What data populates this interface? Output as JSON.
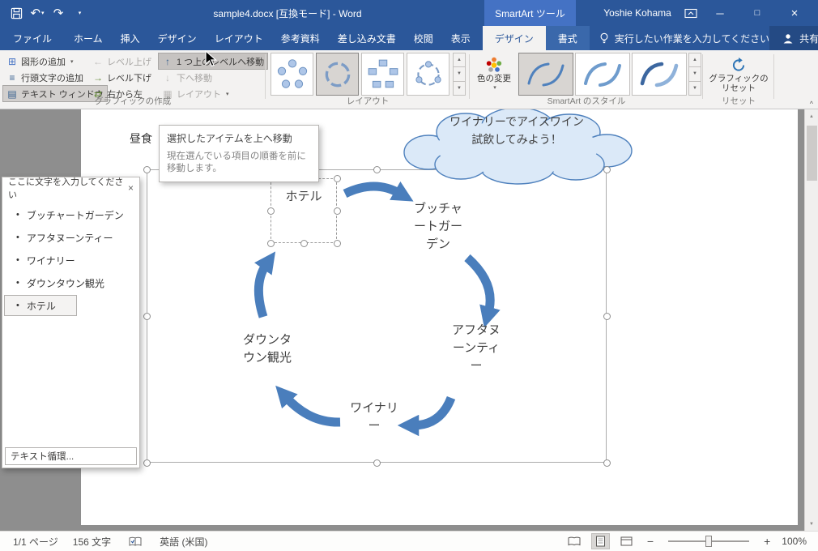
{
  "colors": {
    "titlebar": "#2b579a",
    "contextual_tab": "#4472c4",
    "ribbon_bg": "#f3f2f1",
    "smartart_blue": "#4a7ebc",
    "cloud_fill": "#dbe9f8",
    "cloud_stroke": "#4f81bd"
  },
  "icons": {
    "undo": "↶",
    "redo": "↷",
    "qat_more": "▾",
    "dropdown": "▾",
    "bullet": "•",
    "minimize": "─",
    "maximize": "□",
    "close": "×",
    "add_shape": "⊞",
    "add_bullet": "≡",
    "text_pane": "▤",
    "promote": "←",
    "demote": "→",
    "right_to_left": "⇄",
    "move_up": "↑",
    "move_down": "↓",
    "layout": "▦",
    "gallery_up": "▲",
    "gallery_down": "▼",
    "gallery_more": "▼",
    "pane_close": "×",
    "scroll_up": "▲",
    "scroll_down": "▼",
    "collapse_ribbon": "^"
  },
  "titlebar": {
    "title": "sample4.docx [互換モード] - Word",
    "contextual_group": "SmartArt ツール",
    "user_name": "Yoshie Kohama"
  },
  "tabs": {
    "file": "ファイル",
    "home": "ホーム",
    "insert": "挿入",
    "design": "デザイン",
    "layout": "レイアウト",
    "references": "参考資料",
    "mailings": "差し込み文書",
    "review": "校閲",
    "view": "表示",
    "sa_design": "デザイン",
    "sa_format": "書式",
    "tellme": "実行したい作業を入力してください",
    "share": "共有"
  },
  "ribbon": {
    "group_create": "グラフィックの作成",
    "group_layouts": "レイアウト",
    "group_styles": "SmartArt のスタイル",
    "group_reset": "リセット",
    "add_shape": "図形の追加",
    "add_bullet": "行頭文字の追加",
    "text_pane": "テキスト ウィンドウ",
    "promote": "レベル上げ",
    "demote": "レベル下げ",
    "right_to_left": "右から左",
    "move_up": "1 つ上のレベルへ移動",
    "move_down": "下へ移動",
    "layout_btn": "レイアウト",
    "change_colors": "色の変更",
    "reset_graphic": "グラフィックの\nリセット"
  },
  "tooltip": {
    "title": "選択したアイテムを上へ移動",
    "body": "現在選んでいる項目の順番を前に\n移動します。"
  },
  "text_pane": {
    "title": "ここに文字を入力してください",
    "items": [
      "ブッチャートガーデン",
      "アフタヌーンティー",
      "ワイナリー",
      "ダウンタウン観光",
      "ホテル"
    ],
    "footer": "テキスト循環..."
  },
  "doc": {
    "body_text": "昼食",
    "cloud_text": "ワイナリーでアイスワイン\n試飲してみよう！",
    "nodes": [
      {
        "label": "ホテル"
      },
      {
        "label": "ブッチャ\nートガー\nデン"
      },
      {
        "label": "アフタヌ\nーンティ\nー"
      },
      {
        "label": "ワイナリ\nー"
      },
      {
        "label": "ダウンタ\nウン観光"
      }
    ]
  },
  "status": {
    "page": "1/1 ページ",
    "words": "156 文字",
    "language": "英語 (米国)",
    "zoom_out": "−",
    "zoom_in": "+",
    "zoom_level": "100%"
  }
}
